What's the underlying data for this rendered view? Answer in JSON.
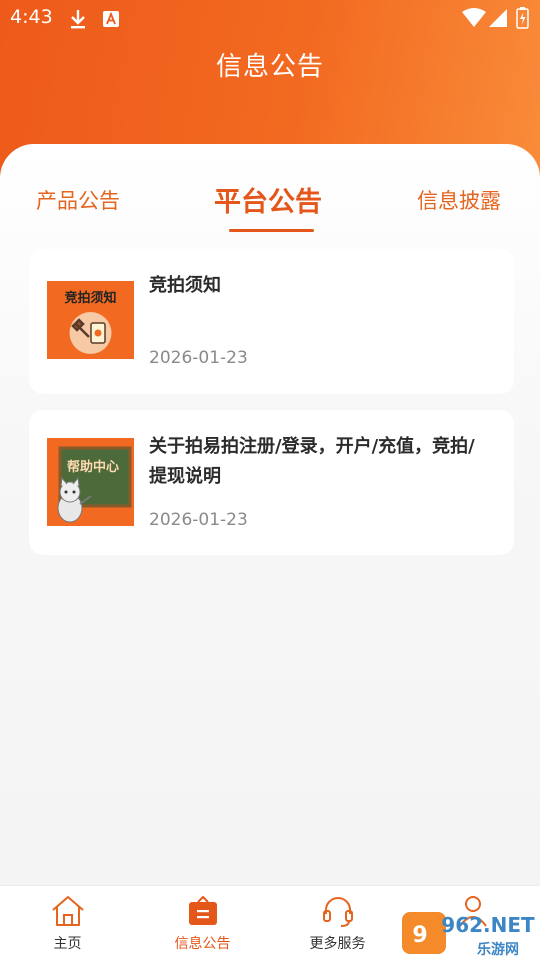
{
  "status_bar": {
    "time": "4:43"
  },
  "header": {
    "title": "信息公告"
  },
  "tabs": [
    {
      "label": "产品公告",
      "active": false
    },
    {
      "label": "平台公告",
      "active": true
    },
    {
      "label": "信息披露",
      "active": false
    }
  ],
  "notices": [
    {
      "title": "竞拍须知",
      "date": "2026-01-23",
      "thumb_text": "竞拍须知"
    },
    {
      "title": "关于拍易拍注册/登录，开户/充值，竞拍/提现说明",
      "date": "2026-01-23",
      "thumb_text": "帮助中心"
    }
  ],
  "bottom_nav": [
    {
      "label": "主页",
      "icon": "home-icon",
      "active": false
    },
    {
      "label": "信息公告",
      "icon": "notice-icon",
      "active": true
    },
    {
      "label": "更多服务",
      "icon": "headset-icon",
      "active": false
    },
    {
      "label": "",
      "icon": "user-icon",
      "active": false
    }
  ],
  "watermark": {
    "text": "962.NET",
    "subtext": "乐游网"
  },
  "colors": {
    "accent": "#e4561a",
    "header_start": "#ee5a1a",
    "header_end": "#f98c3a"
  }
}
